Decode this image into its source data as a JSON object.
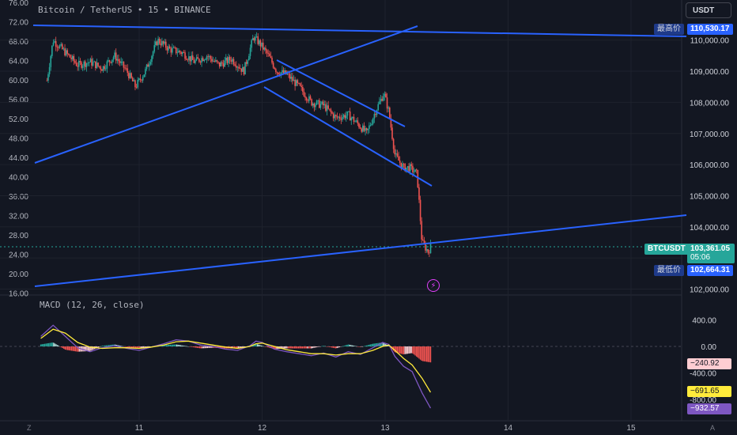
{
  "header": {
    "symbol": "Bitcoin / TetherUS",
    "sep1": "•",
    "interval": "15",
    "sep2": "•",
    "exchange": "BINANCE"
  },
  "currency_button": "USDT",
  "macd_title": "MACD (12, 26, close)",
  "price_labels": {
    "high_tag": "最高价",
    "high_value": "110,530.17",
    "symbol_tag": "BTCUSDT",
    "last_value": "103,361.05",
    "countdown": "05:06",
    "low_tag": "最低价",
    "low_value": "102,664.31"
  },
  "macd_labels": {
    "histogram": "−240.92",
    "signal": "−691.65",
    "macd": "−932.57"
  },
  "icons": {
    "event_marker": "lightning-icon"
  },
  "axis_corner": {
    "left": "Z",
    "right": "A"
  },
  "colors": {
    "background": "#131722",
    "up": "#26a69a",
    "down": "#ef5350",
    "trendline": "#2962ff",
    "macd_line": "#7e57c2",
    "signal_line": "#ffeb3b",
    "grid": "#1e222d"
  },
  "chart_data": [
    {
      "type": "candlestick",
      "title": "Bitcoin / TetherUS · 15 · BINANCE",
      "x_tick_labels": [
        "11",
        "12",
        "13",
        "14",
        "15"
      ],
      "left_axis": {
        "min": 16,
        "max": 76,
        "ticks": [
          "76.00",
          "72.00",
          "68.00",
          "64.00",
          "60.00",
          "56.00",
          "52.00",
          "48.00",
          "44.00",
          "40.00",
          "36.00",
          "32.00",
          "28.00",
          "24.00",
          "20.00",
          "16.00"
        ]
      },
      "right_axis": {
        "min": 102000,
        "max": 111000,
        "ticks": [
          "110,000.00",
          "109,000.00",
          "108,000.00",
          "107,000.00",
          "106,000.00",
          "105,000.00",
          "104,000.00",
          "103,000.00",
          "102,000.00"
        ]
      },
      "price_path": [
        [
          10.25,
          108700
        ],
        [
          10.3,
          110000
        ],
        [
          10.4,
          109600
        ],
        [
          10.5,
          109200
        ],
        [
          10.6,
          109300
        ],
        [
          10.7,
          109100
        ],
        [
          10.8,
          109500
        ],
        [
          10.9,
          109000
        ],
        [
          10.97,
          108500
        ],
        [
          11.05,
          109000
        ],
        [
          11.15,
          110000
        ],
        [
          11.25,
          109700
        ],
        [
          11.35,
          109600
        ],
        [
          11.45,
          109300
        ],
        [
          11.55,
          109500
        ],
        [
          11.65,
          109200
        ],
        [
          11.75,
          109400
        ],
        [
          11.85,
          109000
        ],
        [
          11.93,
          110100
        ],
        [
          11.98,
          109900
        ],
        [
          12.05,
          109500
        ],
        [
          12.12,
          109000
        ],
        [
          12.2,
          108900
        ],
        [
          12.3,
          108500
        ],
        [
          12.4,
          108000
        ],
        [
          12.5,
          107900
        ],
        [
          12.6,
          107500
        ],
        [
          12.7,
          107600
        ],
        [
          12.78,
          107300
        ],
        [
          12.85,
          107000
        ],
        [
          12.92,
          107700
        ],
        [
          12.99,
          108300
        ],
        [
          13.03,
          107700
        ],
        [
          13.08,
          106300
        ],
        [
          13.15,
          105900
        ],
        [
          13.2,
          105900
        ],
        [
          13.26,
          105700
        ],
        [
          13.3,
          103500
        ],
        [
          13.35,
          103200
        ],
        [
          13.37,
          103361
        ]
      ],
      "high": 110530.17,
      "low": 102664.31,
      "last": 103361.05
    },
    {
      "type": "line",
      "title": "MACD (12, 26, close)",
      "y_ticks": [
        "400.00",
        "0.00",
        "-400.00",
        "-800.00"
      ],
      "series": [
        {
          "name": "MACD",
          "values": [
            [
              10.2,
              150
            ],
            [
              10.3,
              320
            ],
            [
              10.4,
              150
            ],
            [
              10.5,
              -20
            ],
            [
              10.6,
              -80
            ],
            [
              10.7,
              -20
            ],
            [
              10.8,
              10
            ],
            [
              10.9,
              -30
            ],
            [
              11.0,
              -60
            ],
            [
              11.1,
              -10
            ],
            [
              11.2,
              40
            ],
            [
              11.3,
              100
            ],
            [
              11.4,
              80
            ],
            [
              11.5,
              20
            ],
            [
              11.6,
              0
            ],
            [
              11.7,
              -40
            ],
            [
              11.8,
              -60
            ],
            [
              11.9,
              10
            ],
            [
              11.95,
              80
            ],
            [
              12.0,
              60
            ],
            [
              12.1,
              -40
            ],
            [
              12.2,
              -80
            ],
            [
              12.3,
              -110
            ],
            [
              12.4,
              -140
            ],
            [
              12.5,
              -100
            ],
            [
              12.6,
              -160
            ],
            [
              12.7,
              -80
            ],
            [
              12.8,
              -120
            ],
            [
              12.9,
              -20
            ],
            [
              12.98,
              60
            ],
            [
              13.03,
              30
            ],
            [
              13.08,
              -150
            ],
            [
              13.15,
              -300
            ],
            [
              13.22,
              -380
            ],
            [
              13.3,
              -700
            ],
            [
              13.37,
              -932.57
            ]
          ]
        },
        {
          "name": "Signal",
          "values": [
            [
              10.2,
              120
            ],
            [
              10.3,
              260
            ],
            [
              10.4,
              200
            ],
            [
              10.5,
              60
            ],
            [
              10.6,
              -10
            ],
            [
              10.7,
              -30
            ],
            [
              10.8,
              -20
            ],
            [
              10.9,
              -20
            ],
            [
              11.0,
              -30
            ],
            [
              11.1,
              -10
            ],
            [
              11.2,
              20
            ],
            [
              11.3,
              70
            ],
            [
              11.4,
              80
            ],
            [
              11.5,
              50
            ],
            [
              11.6,
              20
            ],
            [
              11.7,
              -10
            ],
            [
              11.8,
              -30
            ],
            [
              11.9,
              0
            ],
            [
              11.95,
              40
            ],
            [
              12.0,
              50
            ],
            [
              12.1,
              0
            ],
            [
              12.2,
              -50
            ],
            [
              12.3,
              -80
            ],
            [
              12.4,
              -110
            ],
            [
              12.5,
              -110
            ],
            [
              12.6,
              -130
            ],
            [
              12.7,
              -110
            ],
            [
              12.8,
              -110
            ],
            [
              12.9,
              -60
            ],
            [
              12.98,
              0
            ],
            [
              13.03,
              20
            ],
            [
              13.08,
              -60
            ],
            [
              13.15,
              -180
            ],
            [
              13.22,
              -280
            ],
            [
              13.3,
              -480
            ],
            [
              13.37,
              -691.65
            ]
          ]
        }
      ],
      "histogram_last": -240.92
    }
  ]
}
